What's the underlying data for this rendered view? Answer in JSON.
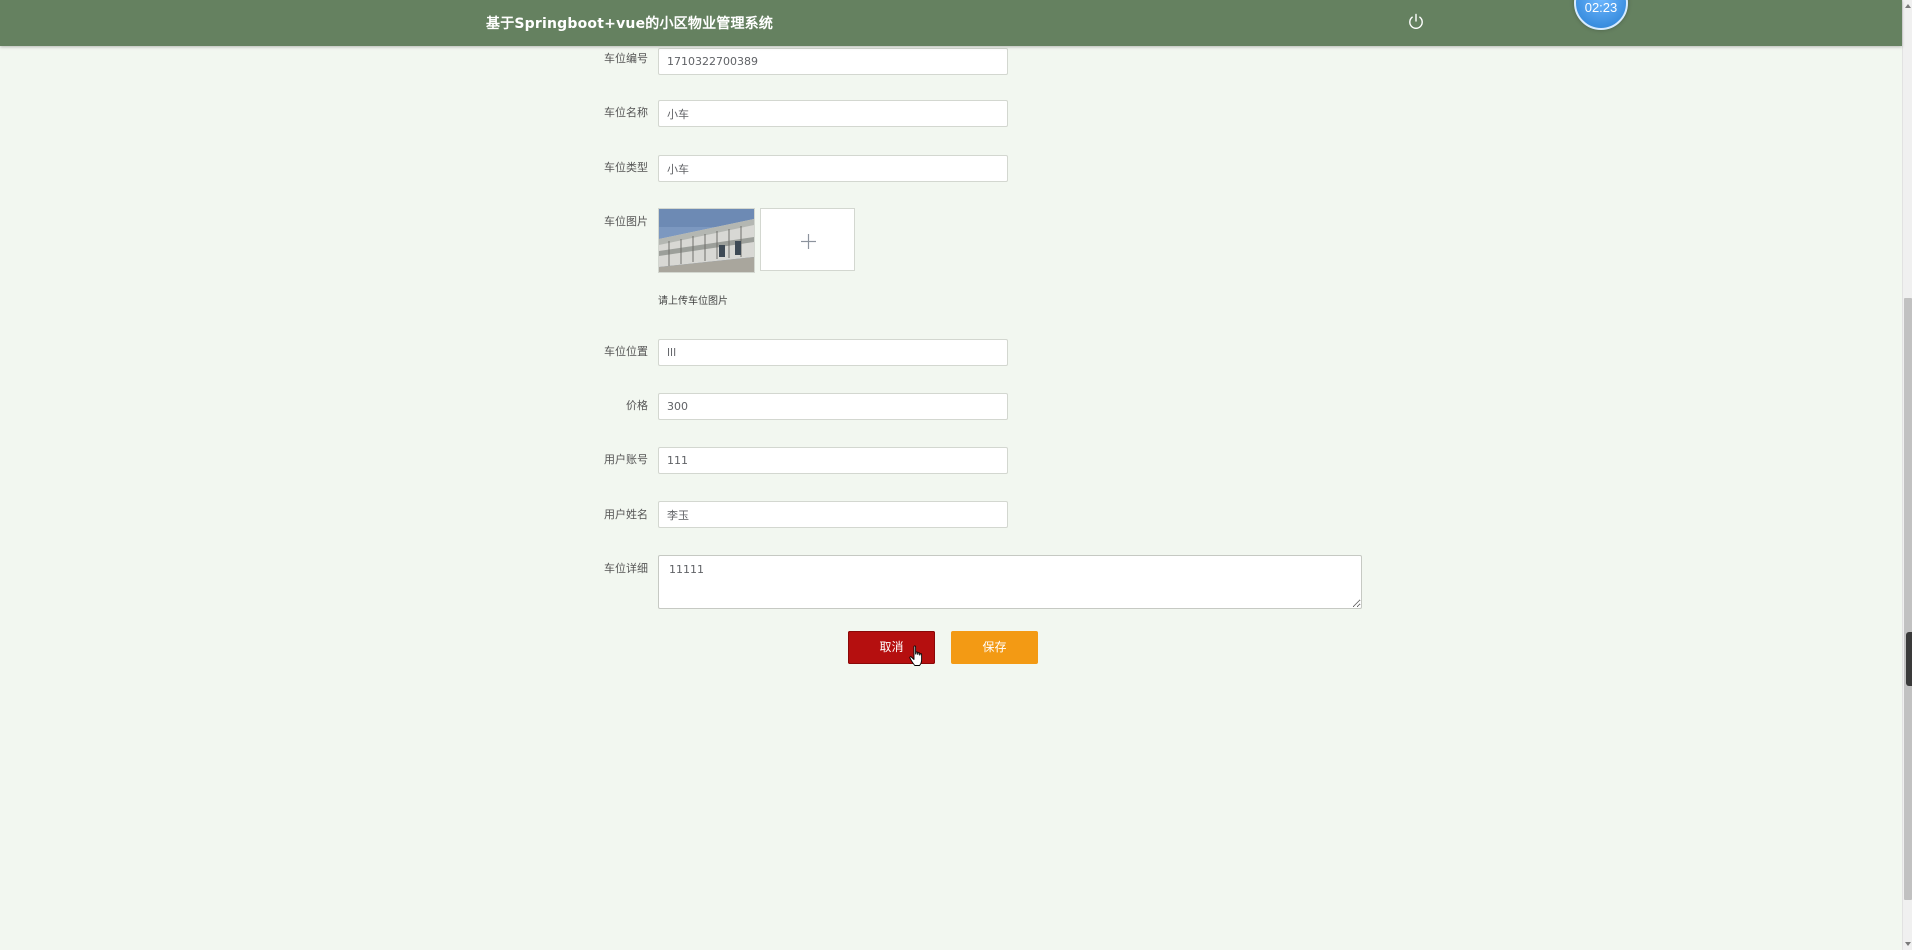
{
  "header": {
    "title": "基于Springboot+vue的小区物业管理系统",
    "clock": "02:23",
    "logout_icon": "power-icon",
    "colors": {
      "bar": "#658160",
      "clock": "#3b8fe0"
    }
  },
  "form": {
    "parking_no": {
      "label": "车位编号",
      "value": "1710322700389"
    },
    "parking_name": {
      "label": "车位名称",
      "value": "小车"
    },
    "parking_type": {
      "label": "车位类型",
      "value": "小车"
    },
    "parking_image": {
      "label": "车位图片",
      "hint": "请上传车位图片",
      "upload_icon": "plus-icon"
    },
    "parking_location": {
      "label": "车位位置",
      "value": "lll"
    },
    "price": {
      "label": "价格",
      "value": "300"
    },
    "user_account": {
      "label": "用户账号",
      "value": "111"
    },
    "user_name": {
      "label": "用户姓名",
      "value": "李玉"
    },
    "parking_detail": {
      "label": "车位详细",
      "value": "11111"
    }
  },
  "actions": {
    "cancel_label": "取消",
    "save_label": "保存",
    "colors": {
      "cancel": "#b50f0f",
      "save": "#f39a14"
    }
  }
}
